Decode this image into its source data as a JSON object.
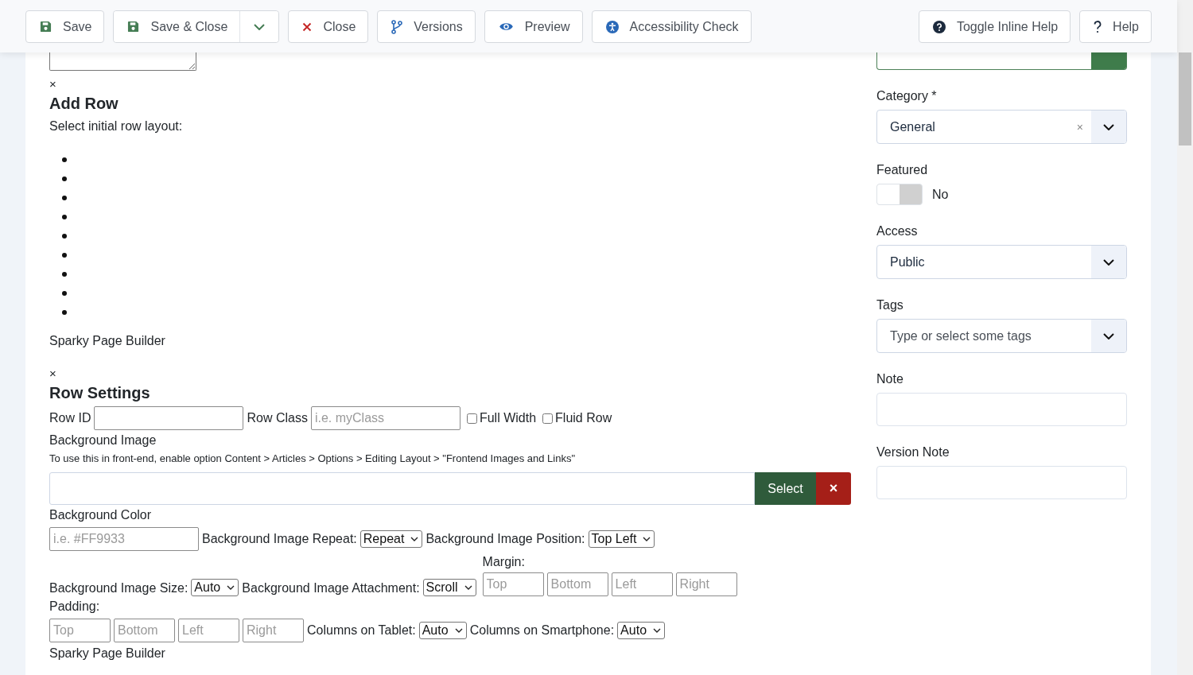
{
  "toolbar": {
    "buttons": [
      {
        "kind": "save",
        "label": "Save"
      },
      {
        "kind": "save",
        "label": "Save & Close",
        "split": true
      },
      {
        "kind": "close",
        "label": "Close"
      },
      {
        "kind": "versions",
        "label": "Versions"
      },
      {
        "kind": "preview",
        "label": "Preview"
      },
      {
        "kind": "accessibility",
        "label": "Accessibility Check"
      }
    ],
    "right_buttons": [
      {
        "kind": "help-circle",
        "label": "Toggle Inline Help"
      },
      {
        "kind": "question",
        "label": "Help"
      }
    ]
  },
  "add_row": {
    "close": "×",
    "title": "Add Row",
    "prompt": "Select initial row layout:",
    "layouts": [
      {
        "kind": "bullet"
      },
      {
        "kind": "bullet"
      },
      {
        "kind": "bullet"
      },
      {
        "kind": "bullet"
      },
      {
        "kind": "bullet"
      },
      {
        "kind": "bullet"
      },
      {
        "kind": "bullet"
      },
      {
        "kind": "bullet"
      },
      {
        "kind": "bullet"
      }
    ],
    "footer": "Sparky Page Builder"
  },
  "row_settings": {
    "close": "×",
    "title": "Row Settings",
    "line_1": [
      {
        "kind": "label",
        "text": "Row ID"
      },
      {
        "kind": "input"
      },
      {
        "kind": "label",
        "text": "Row Class"
      },
      {
        "kind": "input",
        "placeholder": "i.e. myClass"
      },
      {
        "kind": "checkbox",
        "label": "Full Width",
        "checked": false
      },
      {
        "kind": "checkbox",
        "label": "Fluid Row",
        "checked": false
      }
    ],
    "background_image": {
      "label": "Background Image",
      "hint": "To use this in front-end, enable option Content > Articles > Options > Editing Layout > \"Frontend Images and Links\"",
      "select": "Select",
      "clear": "×"
    },
    "background_color_label": "Background Color",
    "line_2": [
      {
        "kind": "input",
        "placeholder": "i.e. #FF9933"
      },
      {
        "kind": "label",
        "text": "Background Image Repeat:"
      },
      {
        "kind": "select",
        "value": "Repeat"
      },
      {
        "kind": "label",
        "text": "Background Image Position:"
      },
      {
        "kind": "select",
        "value": "Top Left"
      }
    ],
    "line_3": [
      {
        "kind": "label",
        "text": "Background Image Size:"
      },
      {
        "kind": "select",
        "value": "Auto"
      },
      {
        "kind": "label",
        "text": "Background Image Attachment:"
      },
      {
        "kind": "select",
        "value": "Scroll"
      },
      {
        "kind": "group",
        "label": "Margin:",
        "inputs": [
          {
            "placeholder": "Top"
          },
          {
            "placeholder": "Bottom"
          },
          {
            "placeholder": "Left"
          },
          {
            "placeholder": "Right"
          }
        ]
      }
    ],
    "padding_label": "Padding:",
    "line_4": [
      {
        "kind": "short",
        "placeholder": "Top"
      },
      {
        "kind": "short",
        "placeholder": "Bottom"
      },
      {
        "kind": "short",
        "placeholder": "Left"
      },
      {
        "kind": "short",
        "placeholder": "Right"
      },
      {
        "kind": "label",
        "text": "Columns on Tablet:"
      },
      {
        "kind": "select",
        "value": "Auto"
      },
      {
        "kind": "label",
        "text": "Columns on Smartphone:"
      },
      {
        "kind": "select",
        "value": "Auto"
      }
    ],
    "footer": "Sparky Page Builder"
  },
  "sidebar": {
    "category": {
      "label": "Category *",
      "value": "General",
      "clear": "×"
    },
    "featured": {
      "label": "Featured",
      "on": false,
      "text": "No"
    },
    "access": {
      "label": "Access",
      "value": "Public"
    },
    "tags": {
      "label": "Tags",
      "placeholder": "Type or select some tags"
    },
    "note": {
      "label": "Note"
    },
    "version_note": {
      "label": "Version Note"
    }
  }
}
